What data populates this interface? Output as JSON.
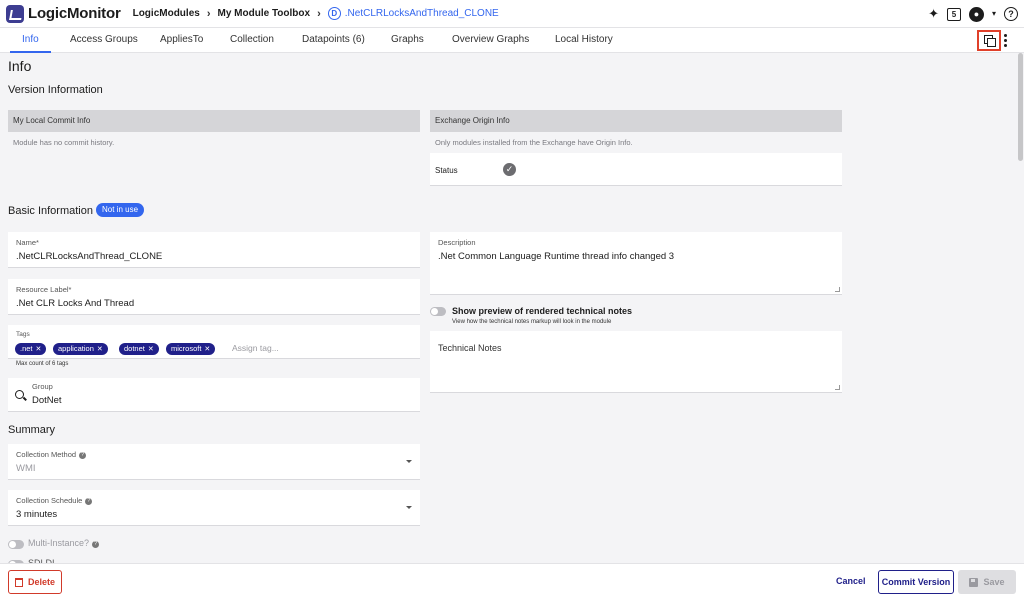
{
  "header": {
    "logo_text": "LogicMonitor",
    "breadcrumbs": [
      "LogicModules",
      "My Module Toolbox"
    ],
    "breadcrumb_sep": "›",
    "current_module": ".NetCLRLocksAndThread_CLONE",
    "module_badge": "D",
    "icons": [
      "sparkle-icon",
      "notification-icon",
      "user-account-icon",
      "help-icon"
    ],
    "notification_glyph": "5",
    "help_glyph": "?"
  },
  "tabs": [
    {
      "label": "Info",
      "active": true
    },
    {
      "label": "Access Groups"
    },
    {
      "label": "AppliesTo"
    },
    {
      "label": "Collection"
    },
    {
      "label": "Datapoints (6)"
    },
    {
      "label": "Graphs"
    },
    {
      "label": "Overview Graphs"
    },
    {
      "label": "Local History"
    }
  ],
  "page": {
    "title": "Info",
    "version_section": "Version Information",
    "local_commit": {
      "heading": "My Local Commit Info",
      "message": "Module has no commit history."
    },
    "exchange_origin": {
      "heading": "Exchange Origin Info",
      "message": "Only modules installed from the Exchange have Origin Info.",
      "status_label": "Status"
    },
    "basic_section": "Basic Information",
    "basic_badge": "Not in use",
    "name": {
      "label": "Name*",
      "value": ".NetCLRLocksAndThread_CLONE"
    },
    "resource_label": {
      "label": "Resource Label*",
      "value": ".Net CLR Locks And Thread"
    },
    "tags": {
      "label": "Tags",
      "items": [
        ".net",
        "application",
        "dotnet",
        "microsoft"
      ],
      "placeholder": "Assign tag...",
      "helper": "Max count of 6 tags"
    },
    "group": {
      "label": "Group",
      "value": "DotNet"
    },
    "description": {
      "label": "Description",
      "value": ".Net Common Language Runtime thread info changed 3"
    },
    "preview_toggle": {
      "label": "Show preview of rendered technical notes",
      "help": "View how the technical notes markup will look in the module",
      "on": false
    },
    "technical_notes": {
      "placeholder": "Technical Notes"
    },
    "summary_section": "Summary",
    "collection_method": {
      "label": "Collection Method",
      "value": "WMI",
      "disabled": true
    },
    "collection_schedule": {
      "label": "Collection Schedule",
      "value": "3 minutes"
    },
    "multi_instance": {
      "label": "Multi-Instance?",
      "on": false
    },
    "next_toggle_partial": "SDLDI"
  },
  "footer": {
    "delete_label": "Delete",
    "cancel_label": "Cancel",
    "commit_label": "Commit Version",
    "save_label": "Save"
  },
  "colors": {
    "accent": "#3366ee",
    "navy": "#20208a",
    "danger": "#d13a2a",
    "highlight_box": "#e0402a"
  }
}
